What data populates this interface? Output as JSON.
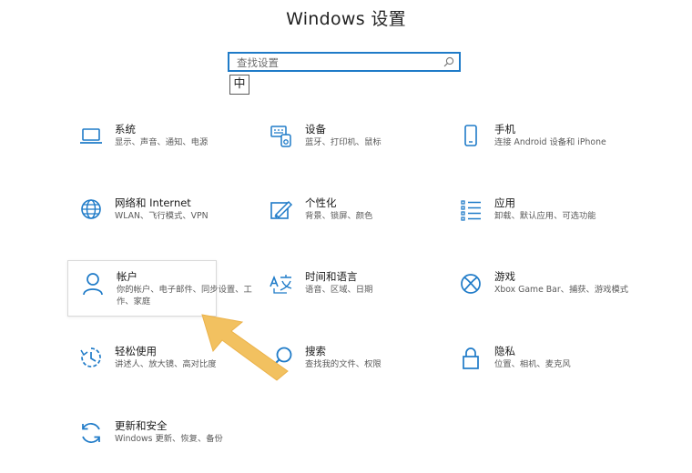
{
  "window": {
    "title": "Windows 设置"
  },
  "search": {
    "placeholder": "查找设置"
  },
  "ime": {
    "label": "中"
  },
  "colors": {
    "accent": "#1f7bc8",
    "arrow": "#f2c160"
  },
  "tiles": [
    {
      "name": "系统",
      "desc": "显示、声音、通知、电源",
      "icon": "laptop-icon"
    },
    {
      "name": "设备",
      "desc": "蓝牙、打印机、鼠标",
      "icon": "devices-icon"
    },
    {
      "name": "手机",
      "desc": "连接 Android 设备和 iPhone",
      "icon": "phone-icon"
    },
    {
      "name": "网络和 Internet",
      "desc": "WLAN、飞行模式、VPN",
      "icon": "globe-icon"
    },
    {
      "name": "个性化",
      "desc": "背景、锁屏、颜色",
      "icon": "paint-icon"
    },
    {
      "name": "应用",
      "desc": "卸载、默认应用、可选功能",
      "icon": "apps-list-icon"
    },
    {
      "name": "帐户",
      "desc": "你的帐户、电子邮件、同步设置、工作、家庭",
      "icon": "person-icon"
    },
    {
      "name": "时间和语言",
      "desc": "语音、区域、日期",
      "icon": "time-language-icon"
    },
    {
      "name": "游戏",
      "desc": "Xbox Game Bar、捕获、游戏模式",
      "icon": "xbox-icon"
    },
    {
      "name": "轻松使用",
      "desc": "讲述人、放大镜、高对比度",
      "icon": "ease-of-access-icon"
    },
    {
      "name": "搜索",
      "desc": "查找我的文件、权限",
      "icon": "search-icon"
    },
    {
      "name": "隐私",
      "desc": "位置、相机、麦克风",
      "icon": "lock-icon"
    },
    {
      "name": "更新和安全",
      "desc": "Windows 更新、恢复、备份",
      "icon": "update-icon"
    }
  ]
}
